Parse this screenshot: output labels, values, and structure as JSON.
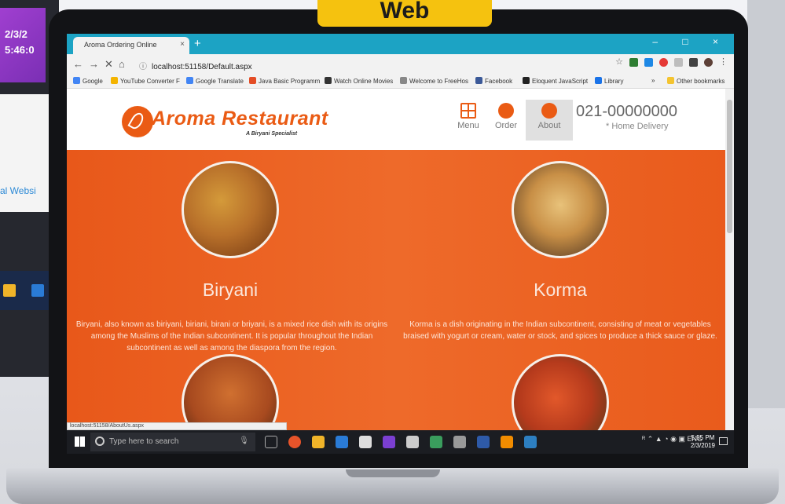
{
  "overlay": {
    "banner": "Web",
    "bg_date": "2/3/2",
    "bg_time": "5:46:0",
    "bg_link": "al Websi"
  },
  "browser": {
    "tab_title": "Aroma Ordering Online",
    "tab_close": "×",
    "new_tab": "+",
    "window_controls": "– □ ×",
    "url": "localhost:51158/Default.aspx",
    "status_url": "localhost:51158/AboutUs.aspx",
    "bookmarks": [
      {
        "label": "Google",
        "color": "#4285f4"
      },
      {
        "label": "YouTube Converter F",
        "color": "#f4b400"
      },
      {
        "label": "Google Translate",
        "color": "#4285f4"
      },
      {
        "label": "Java Basic Programm",
        "color": "#e44d26"
      },
      {
        "label": "Watch Online Movies",
        "color": "#333333"
      },
      {
        "label": "Welcome to FreeHos",
        "color": "#888888"
      },
      {
        "label": "Facebook",
        "color": "#3b5998"
      },
      {
        "label": "Eloquent JavaScript",
        "color": "#222222"
      },
      {
        "label": "Library",
        "color": "#1a73e8"
      },
      {
        "label": "»",
        "color": "#f2f2f2"
      },
      {
        "label": "Other bookmarks",
        "color": "#f4c430"
      }
    ]
  },
  "site": {
    "logo_text": "Aroma Restaurant",
    "logo_tagline": "A Biryani Specialist",
    "nav": [
      {
        "label": "Menu",
        "icon": "grid-icon"
      },
      {
        "label": "Order",
        "icon": "order-icon"
      },
      {
        "label": "About",
        "icon": "home-icon"
      }
    ],
    "phone": "021-00000000",
    "delivery": "* Home Delivery"
  },
  "dishes": [
    {
      "name": "Biryani",
      "description": "Biryani, also known as biriyani, biriani, birani or briyani, is a mixed rice dish with its origins among the Muslims of the Indian subcontinent. It is popular throughout the Indian subcontinent as well as among the diaspora from the region."
    },
    {
      "name": "Korma",
      "description": "Korma is a dish originating in the Indian subcontinent, consisting of meat or vegetables braised with yogurt or cream, water or stock, and spices to produce a thick sauce or glaze."
    }
  ],
  "taskbar": {
    "search_placeholder": "Type here to search",
    "lang": "ENG",
    "time": "5:55 PM",
    "date": "2/3/2019"
  },
  "colors": {
    "accent": "#ea5b14",
    "browser_tab": "#1ca3c4",
    "banner": "#f5c20f"
  }
}
